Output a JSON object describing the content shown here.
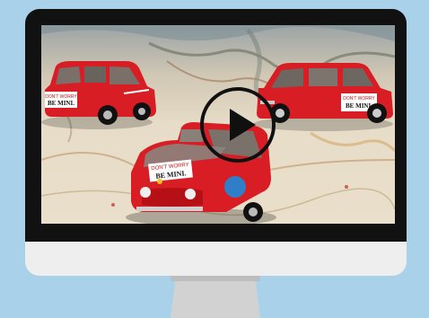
{
  "video": {
    "sticker_line1": "DON'T WORRY",
    "sticker_line2": "BE MINI."
  },
  "colors": {
    "background": "#a9d2ea",
    "bezel": "#111111",
    "chin": "#eeeeee",
    "car_red": "#d81e24",
    "map_base": "#e6dcc8"
  },
  "icons": {
    "play": "play-icon"
  }
}
